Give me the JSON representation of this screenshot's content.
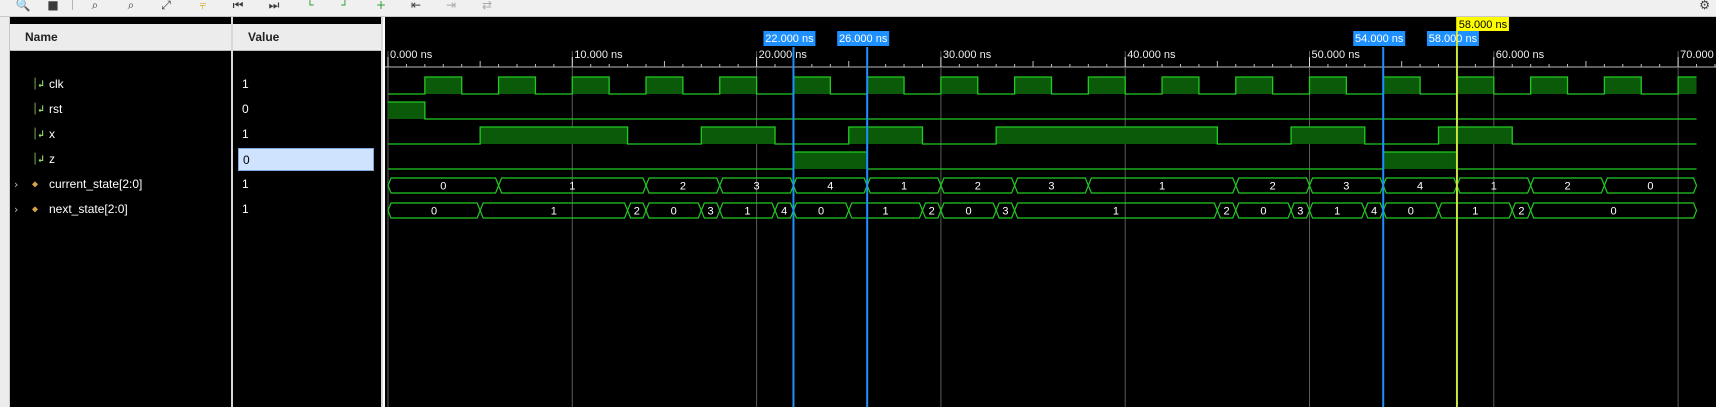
{
  "toolbar": {
    "icons": [
      "zoom-in-icon",
      "save-icon",
      "zoom-fit-icon",
      "zoom-out-icon",
      "full-view-icon",
      "go-to-cursor-icon",
      "first-icon",
      "last-icon",
      "prev-transition-icon",
      "next-transition-icon",
      "add-marker-icon",
      "prev-marker-icon",
      "next-marker-icon",
      "swap-cursors-icon"
    ],
    "settings_icon": "gear-icon"
  },
  "panels": {
    "name_header": "Name",
    "value_header": "Value"
  },
  "signals": [
    {
      "name": "clk",
      "value": "1",
      "kind": "bit",
      "expandable": false
    },
    {
      "name": "rst",
      "value": "0",
      "kind": "bit",
      "expandable": false
    },
    {
      "name": "x",
      "value": "1",
      "kind": "bit",
      "expandable": false
    },
    {
      "name": "z",
      "value": "0",
      "kind": "bit",
      "expandable": false,
      "selected": true
    },
    {
      "name": "current_state[2:0]",
      "value": "1",
      "kind": "bus",
      "expandable": true
    },
    {
      "name": "next_state[2:0]",
      "value": "1",
      "kind": "bus",
      "expandable": true
    }
  ],
  "time_axis": {
    "ticks": [
      {
        "t": 0,
        "label": "0.000 ns"
      },
      {
        "t": 10,
        "label": "10.000 ns"
      },
      {
        "t": 20,
        "label": "20.000 ns"
      },
      {
        "t": 30,
        "label": "30.000 ns"
      },
      {
        "t": 40,
        "label": "40.000 ns"
      },
      {
        "t": 50,
        "label": "50.000 ns"
      },
      {
        "t": 60,
        "label": "60.000 ns"
      },
      {
        "t": 70,
        "label": "70.000 ns"
      }
    ]
  },
  "markers": [
    {
      "t": 22,
      "label": "22.000 ns",
      "kind": "marker"
    },
    {
      "t": 26,
      "label": "26.000 ns",
      "kind": "marker"
    },
    {
      "t": 54,
      "label": "54.000 ns",
      "kind": "marker"
    },
    {
      "t": 58,
      "label": "58.000 ns",
      "kind": "marker"
    }
  ],
  "cursor": {
    "t": 58,
    "label": "58.000 ns"
  },
  "waveforms": {
    "clk": [
      [
        0,
        0
      ],
      [
        2,
        1
      ],
      [
        4,
        0
      ],
      [
        6,
        1
      ],
      [
        8,
        0
      ],
      [
        10,
        1
      ],
      [
        12,
        0
      ],
      [
        14,
        1
      ],
      [
        16,
        0
      ],
      [
        18,
        1
      ],
      [
        20,
        0
      ],
      [
        22,
        1
      ],
      [
        24,
        0
      ],
      [
        26,
        1
      ],
      [
        28,
        0
      ],
      [
        30,
        1
      ],
      [
        32,
        0
      ],
      [
        34,
        1
      ],
      [
        36,
        0
      ],
      [
        38,
        1
      ],
      [
        40,
        0
      ],
      [
        42,
        1
      ],
      [
        44,
        0
      ],
      [
        46,
        1
      ],
      [
        48,
        0
      ],
      [
        50,
        1
      ],
      [
        52,
        0
      ],
      [
        54,
        1
      ],
      [
        56,
        0
      ],
      [
        58,
        1
      ],
      [
        60,
        0
      ],
      [
        62,
        1
      ],
      [
        64,
        0
      ],
      [
        66,
        1
      ],
      [
        68,
        0
      ],
      [
        70,
        1
      ],
      [
        71,
        1
      ]
    ],
    "rst": [
      [
        0,
        1
      ],
      [
        2,
        0
      ],
      [
        71,
        0
      ]
    ],
    "x": [
      [
        0,
        0
      ],
      [
        5,
        1
      ],
      [
        13,
        0
      ],
      [
        17,
        1
      ],
      [
        21,
        0
      ],
      [
        25,
        1
      ],
      [
        29,
        0
      ],
      [
        33,
        1
      ],
      [
        45,
        0
      ],
      [
        49,
        1
      ],
      [
        53,
        0
      ],
      [
        57,
        1
      ],
      [
        61,
        0
      ],
      [
        71,
        0
      ]
    ],
    "z": [
      [
        0,
        0
      ],
      [
        22,
        1
      ],
      [
        26,
        0
      ],
      [
        54,
        1
      ],
      [
        58,
        0
      ],
      [
        71,
        0
      ]
    ],
    "current_state": [
      {
        "from": 0,
        "to": 6,
        "label": "0"
      },
      {
        "from": 6,
        "to": 14,
        "label": "1"
      },
      {
        "from": 14,
        "to": 18,
        "label": "2"
      },
      {
        "from": 18,
        "to": 22,
        "label": "3"
      },
      {
        "from": 22,
        "to": 26,
        "label": "4"
      },
      {
        "from": 26,
        "to": 30,
        "label": "1"
      },
      {
        "from": 30,
        "to": 34,
        "label": "2"
      },
      {
        "from": 34,
        "to": 38,
        "label": "3"
      },
      {
        "from": 38,
        "to": 46,
        "label": "1"
      },
      {
        "from": 46,
        "to": 50,
        "label": "2"
      },
      {
        "from": 50,
        "to": 54,
        "label": "3"
      },
      {
        "from": 54,
        "to": 58,
        "label": "4"
      },
      {
        "from": 58,
        "to": 62,
        "label": "1"
      },
      {
        "from": 62,
        "to": 66,
        "label": "2"
      },
      {
        "from": 66,
        "to": 71,
        "label": "0"
      }
    ],
    "next_state": [
      {
        "from": 0,
        "to": 5,
        "label": "0"
      },
      {
        "from": 5,
        "to": 13,
        "label": "1"
      },
      {
        "from": 13,
        "to": 14,
        "label": "2"
      },
      {
        "from": 14,
        "to": 17,
        "label": "0"
      },
      {
        "from": 17,
        "to": 18,
        "label": "3"
      },
      {
        "from": 18,
        "to": 21,
        "label": "1"
      },
      {
        "from": 21,
        "to": 22,
        "label": "4"
      },
      {
        "from": 22,
        "to": 25,
        "label": "0"
      },
      {
        "from": 25,
        "to": 29,
        "label": "1"
      },
      {
        "from": 29,
        "to": 30,
        "label": "2"
      },
      {
        "from": 30,
        "to": 33,
        "label": "0"
      },
      {
        "from": 33,
        "to": 34,
        "label": "3"
      },
      {
        "from": 34,
        "to": 45,
        "label": "1"
      },
      {
        "from": 45,
        "to": 46,
        "label": "2"
      },
      {
        "from": 46,
        "to": 49,
        "label": "0"
      },
      {
        "from": 49,
        "to": 50,
        "label": "3"
      },
      {
        "from": 50,
        "to": 53,
        "label": "1"
      },
      {
        "from": 53,
        "to": 54,
        "label": "4"
      },
      {
        "from": 54,
        "to": 57,
        "label": "0"
      },
      {
        "from": 57,
        "to": 61,
        "label": "1"
      },
      {
        "from": 61,
        "to": 62,
        "label": "2"
      },
      {
        "from": 62,
        "to": 71,
        "label": "0"
      }
    ]
  },
  "colors": {
    "wave": "#22c922",
    "wave_fill": "#0a5a0a",
    "marker": "#1e90ff",
    "cursor": "#ffff00",
    "grid": "#5a5a5a"
  }
}
